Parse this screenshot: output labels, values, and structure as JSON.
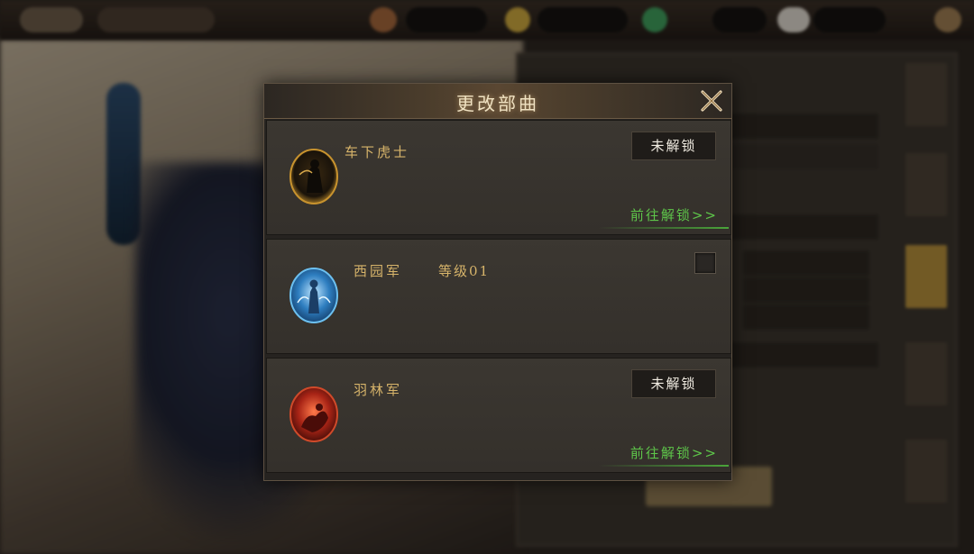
{
  "dialog": {
    "title": "更改部曲"
  },
  "units": [
    {
      "name": "车下虎士",
      "level": "",
      "status": "未解锁",
      "link": "前往解锁>>",
      "portrait_color": "#c8932e"
    },
    {
      "name": "西园军",
      "level": "等级01",
      "status": "",
      "link": "",
      "portrait_color": "#3a9ad8"
    },
    {
      "name": "羽林军",
      "level": "",
      "status": "未解锁",
      "link": "前往解锁>>",
      "portrait_color": "#c8331e"
    }
  ],
  "colors": {
    "accent_gold": "#d7b46a",
    "link_green": "#5ec64a",
    "panel": "#3b3731"
  }
}
